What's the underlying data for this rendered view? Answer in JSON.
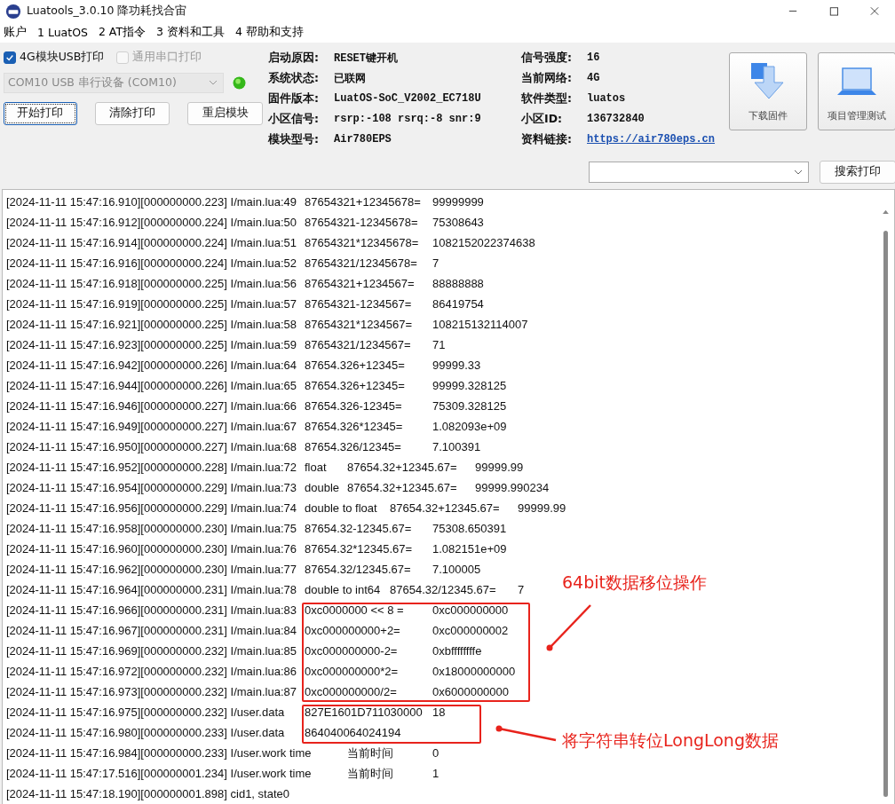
{
  "window": {
    "title": "Luatools_3.0.10 降功耗找合宙"
  },
  "menu": [
    "账户",
    "1 LuatOS",
    "2 AT指令",
    "3 资料和工具",
    "4 帮助和支持"
  ],
  "options": [
    {
      "label": "4G模块USB打印",
      "checked": true,
      "disabled": false
    },
    {
      "label": "通用串口打印",
      "checked": false,
      "disabled": true
    }
  ],
  "port": {
    "value": "COM10 USB 串行设备 (COM10)",
    "connected": true
  },
  "buttons": [
    {
      "label": "开始打印",
      "focused": true
    },
    {
      "label": "清除打印",
      "focused": false
    },
    {
      "label": "重启模块",
      "focused": false
    }
  ],
  "info_left": [
    {
      "label": "启动原因:",
      "value": "RESET键开机"
    },
    {
      "label": "系统状态:",
      "value": "已联网"
    },
    {
      "label": "固件版本:",
      "value": "LuatOS-SoC_V2002_EC718U"
    },
    {
      "label": "小区信号:",
      "value": "rsrp:-108 rsrq:-8 snr:9"
    },
    {
      "label": "模块型号:",
      "value": "Air780EPS"
    }
  ],
  "info_right": [
    {
      "label": "信号强度:",
      "value": "16",
      "kind": "text"
    },
    {
      "label": "当前网络:",
      "value": "4G",
      "kind": "text"
    },
    {
      "label": "软件类型:",
      "value": "luatos",
      "kind": "text"
    },
    {
      "label": "小区ID:",
      "value": "136732840",
      "kind": "text"
    },
    {
      "label": "资料链接:",
      "value": "https://air780eps.cn",
      "kind": "link"
    }
  ],
  "tool_buttons": [
    {
      "label": "下载固件",
      "kind": "download"
    },
    {
      "label": "项目管理测试",
      "kind": "project"
    }
  ],
  "search_button": "搜索打印",
  "log": [
    {
      "segments": [
        "[2024-11-11 15:47:16.910][000000000.223] I/main.lua:49",
        "87654321+12345678=",
        "99999999"
      ]
    },
    {
      "segments": [
        "[2024-11-11 15:47:16.912][000000000.224] I/main.lua:50",
        "87654321-12345678=",
        "75308643"
      ]
    },
    {
      "segments": [
        "[2024-11-11 15:47:16.914][000000000.224] I/main.lua:51",
        "87654321*12345678=",
        "1082152022374638"
      ]
    },
    {
      "segments": [
        "[2024-11-11 15:47:16.916][000000000.224] I/main.lua:52",
        "87654321/12345678=",
        "7"
      ]
    },
    {
      "segments": [
        "[2024-11-11 15:47:16.918][000000000.225] I/main.lua:56",
        "87654321+1234567=",
        "88888888"
      ]
    },
    {
      "segments": [
        "[2024-11-11 15:47:16.919][000000000.225] I/main.lua:57",
        "87654321-1234567=",
        "86419754"
      ]
    },
    {
      "segments": [
        "[2024-11-11 15:47:16.921][000000000.225] I/main.lua:58",
        "87654321*1234567=",
        "108215132114007"
      ]
    },
    {
      "segments": [
        "[2024-11-11 15:47:16.923][000000000.225] I/main.lua:59",
        "87654321/1234567=",
        "71"
      ]
    },
    {
      "segments": [
        "[2024-11-11 15:47:16.942][000000000.226] I/main.lua:64",
        "87654.326+12345=",
        "99999.33"
      ]
    },
    {
      "segments": [
        "[2024-11-11 15:47:16.944][000000000.226] I/main.lua:65",
        "87654.326+12345=",
        "99999.328125"
      ]
    },
    {
      "segments": [
        "[2024-11-11 15:47:16.946][000000000.227] I/main.lua:66",
        "87654.326-12345=",
        "75309.328125"
      ]
    },
    {
      "segments": [
        "[2024-11-11 15:47:16.949][000000000.227] I/main.lua:67",
        "87654.326*12345=",
        "1.082093e+09"
      ]
    },
    {
      "segments": [
        "[2024-11-11 15:47:16.950][000000000.227] I/main.lua:68",
        "87654.326/12345=",
        "7.100391"
      ]
    },
    {
      "segments": [
        "[2024-11-11 15:47:16.952][000000000.228] I/main.lua:72",
        "float",
        "87654.32+12345.67=",
        "99999.99"
      ]
    },
    {
      "segments": [
        "[2024-11-11 15:47:16.954][000000000.229] I/main.lua:73",
        "double",
        "87654.32+12345.67=",
        "99999.990234"
      ]
    },
    {
      "segments": [
        "[2024-11-11 15:47:16.956][000000000.229] I/main.lua:74",
        "double to float",
        "87654.32+12345.67=",
        "99999.99"
      ]
    },
    {
      "segments": [
        "[2024-11-11 15:47:16.958][000000000.230] I/main.lua:75",
        "87654.32-12345.67=",
        "75308.650391"
      ]
    },
    {
      "segments": [
        "[2024-11-11 15:47:16.960][000000000.230] I/main.lua:76",
        "87654.32*12345.67=",
        "1.082151e+09"
      ]
    },
    {
      "segments": [
        "[2024-11-11 15:47:16.962][000000000.230] I/main.lua:77",
        "87654.32/12345.67=",
        "7.100005"
      ]
    },
    {
      "segments": [
        "[2024-11-11 15:47:16.964][000000000.231] I/main.lua:78",
        "double to int64",
        "87654.32/12345.67=",
        "7"
      ]
    },
    {
      "segments": [
        "[2024-11-11 15:47:16.966][000000000.231] I/main.lua:83",
        "0xc0000000 << 8 =",
        "0xc000000000"
      ]
    },
    {
      "segments": [
        "[2024-11-11 15:47:16.967][000000000.231] I/main.lua:84",
        "0xc000000000+2=",
        "0xc000000002"
      ]
    },
    {
      "segments": [
        "[2024-11-11 15:47:16.969][000000000.232] I/main.lua:85",
        "0xc000000000-2=",
        "0xbffffffffe"
      ]
    },
    {
      "segments": [
        "[2024-11-11 15:47:16.972][000000000.232] I/main.lua:86",
        "0xc000000000*2=",
        "0x18000000000"
      ]
    },
    {
      "segments": [
        "[2024-11-11 15:47:16.973][000000000.232] I/main.lua:87",
        "0xc000000000/2=",
        "0x6000000000"
      ]
    },
    {
      "segments": [
        "[2024-11-11 15:47:16.975][000000000.232] I/user.data",
        "827E1601D711030000",
        "18"
      ]
    },
    {
      "segments": [
        "[2024-11-11 15:47:16.980][000000000.233] I/user.data",
        "864040064024194"
      ]
    },
    {
      "segments": [
        "[2024-11-11 15:47:16.984][000000000.233] I/user.work time",
        "当前时间",
        "0"
      ]
    },
    {
      "segments": [
        "[2024-11-11 15:47:17.516][000000001.234] I/user.work time",
        "当前时间",
        "1"
      ]
    },
    {
      "segments": [
        "[2024-11-11 15:47:18.190][000000001.898] cid1, state0"
      ]
    }
  ],
  "annotations": [
    {
      "text": "64bit数据移位操作"
    },
    {
      "text": "将字符串转位LongLong数据"
    }
  ]
}
